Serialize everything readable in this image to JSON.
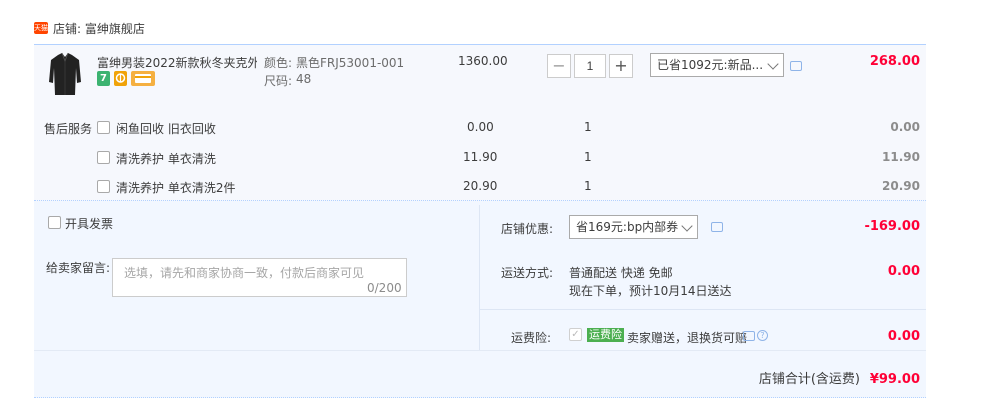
{
  "shop": {
    "label": "店铺: 富绅旗舰店",
    "badge_icon": "tmall-icon"
  },
  "item": {
    "title": "富绅男装2022新款秋冬夹克外...",
    "color_label": "颜色:",
    "color_value": "黑色FRJ53001-001",
    "size_label": "尺码:",
    "size_value": "48",
    "unit_price": "1360.00",
    "quantity": "1",
    "discount_select": "已省1092元:新品...",
    "subtotal": "268.00",
    "badges": [
      {
        "text": "7",
        "color": "#3cb371"
      },
      {
        "text": "券",
        "color": "#f0a30a"
      },
      {
        "text": "卡",
        "color": "#f5b041"
      }
    ]
  },
  "after_sales": {
    "title": "售后服务",
    "services": [
      {
        "name": "闲鱼回收 旧衣回收",
        "price": "0.00",
        "qty": "1",
        "total": "0.00"
      },
      {
        "name": "清洗养护 单衣清洗",
        "price": "11.90",
        "qty": "1",
        "total": "11.90"
      },
      {
        "name": "清洗养护 单衣清洗2件",
        "price": "20.90",
        "qty": "1",
        "total": "20.90"
      }
    ]
  },
  "invoice": {
    "label": "开具发票"
  },
  "message": {
    "label": "给卖家留言:",
    "placeholder": "选填，请先和商家协商一致，付款后商家可见",
    "counter": "0/200"
  },
  "store_discount": {
    "label": "店铺优惠:",
    "select": "省169元:bp内部券",
    "amount": "-169.00"
  },
  "shipping": {
    "label": "运送方式:",
    "method": "普通配送 快递 免邮",
    "eta": "现在下单，预计10月14日送达",
    "amount": "0.00"
  },
  "insurance": {
    "label": "运费险:",
    "tag": "运费险",
    "desc": "卖家赠送，退换货可赔",
    "amount": "0.00"
  },
  "total": {
    "label": "店铺合计(含运费)",
    "amount": "¥99.00"
  },
  "colors": {
    "accent_red": "#ff0036",
    "border_blue": "#b2d1ff",
    "panel_bg": "#f2f7ff"
  }
}
